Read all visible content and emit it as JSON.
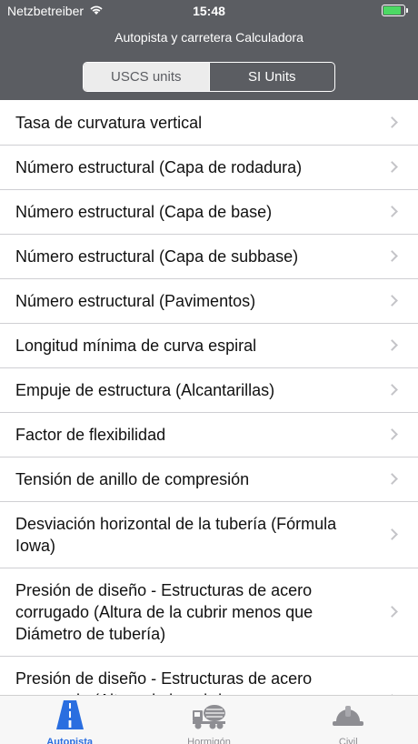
{
  "status_bar": {
    "carrier": "Netzbetreiber",
    "time": "15:48"
  },
  "header": {
    "title": "Autopista y carretera Calculadora"
  },
  "units": {
    "options": [
      "USCS units",
      "SI Units"
    ],
    "selected": "USCS units"
  },
  "list": {
    "items": [
      {
        "label": "Tasa de curvatura vertical"
      },
      {
        "label": "Número estructural (Capa de rodadura)"
      },
      {
        "label": "Número estructural (Capa de base)"
      },
      {
        "label": "Número estructural (Capa de subbase)"
      },
      {
        "label": "Número estructural (Pavimentos)"
      },
      {
        "label": "Longitud mínima de curva espiral"
      },
      {
        "label": "Empuje de estructura (Alcantarillas)"
      },
      {
        "label": "Factor de flexibilidad"
      },
      {
        "label": "Tensión de anillo de compresión"
      },
      {
        "label": "Desviación horizontal de la tubería (Fórmula Iowa)"
      },
      {
        "label": "Presión de diseño - Estructuras de acero corrugado (Altura de la cubrir menos que Diámetro de tubería)"
      },
      {
        "label": "Presión de diseño - Estructuras de acero corrugado (Altura de la cubrir"
      }
    ]
  },
  "tabbar": {
    "tabs": [
      {
        "label": "Autopista",
        "icon": "highway-icon",
        "active": true
      },
      {
        "label": "Hormigón",
        "icon": "concrete-mixer-icon",
        "active": false
      },
      {
        "label": "Civil",
        "icon": "hard-hat-icon",
        "active": false
      }
    ]
  },
  "colors": {
    "header_bg": "#5b5d62",
    "accent": "#2a6ee0",
    "battery": "#4cd964"
  }
}
